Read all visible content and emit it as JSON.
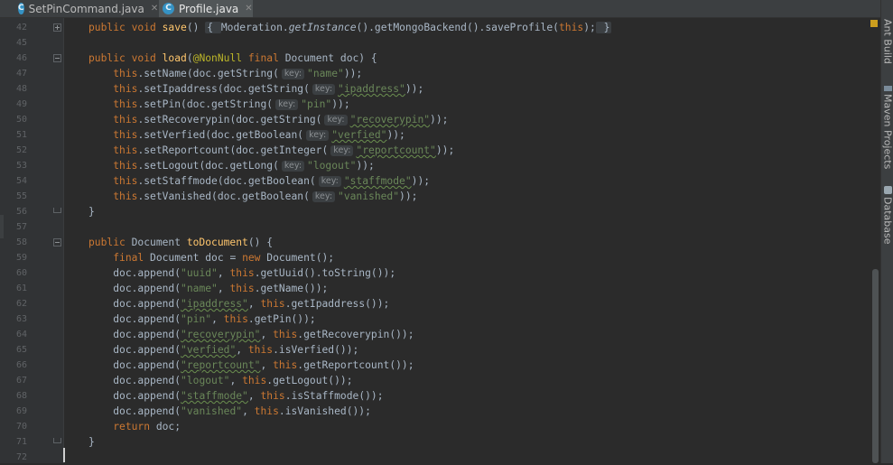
{
  "tabs": [
    {
      "label": "SetPinCommand.java",
      "icon": "class-icon",
      "letter": "C",
      "active": false
    },
    {
      "label": "Profile.java",
      "icon": "class-icon",
      "letter": "C",
      "active": true
    }
  ],
  "right_tool_windows": [
    "Ant Build",
    "Maven Projects",
    "Database"
  ],
  "line_numbers": [
    "42",
    "45",
    "46",
    "47",
    "48",
    "49",
    "50",
    "51",
    "52",
    "53",
    "54",
    "55",
    "56",
    "57",
    "58",
    "59",
    "60",
    "61",
    "62",
    "63",
    "64",
    "65",
    "66",
    "67",
    "68",
    "69",
    "70",
    "71",
    "72"
  ],
  "code_lines": [
    [
      [
        "kw",
        "public void "
      ],
      [
        "fn",
        "save"
      ],
      [
        "tx",
        "() "
      ],
      [
        "fb",
        "{ "
      ],
      [
        "tx",
        "Moderation."
      ],
      [
        "it",
        "getInstance"
      ],
      [
        "tx",
        "().getMongoBackend().saveProfile("
      ],
      [
        "kw",
        "this"
      ],
      [
        "tx",
        ");"
      ],
      [
        "fb",
        " }"
      ]
    ],
    [],
    [
      [
        "kw",
        "public void "
      ],
      [
        "fn",
        "load"
      ],
      [
        "tx",
        "("
      ],
      [
        "ann",
        "@NonNull "
      ],
      [
        "kw",
        "final "
      ],
      [
        "tx",
        "Document doc) {"
      ]
    ],
    [
      [
        "sp",
        "    "
      ],
      [
        "kw",
        "this"
      ],
      [
        "tx",
        ".setName(doc.getString("
      ],
      [
        "hint",
        "key:"
      ],
      [
        "st",
        "\"name\""
      ],
      [
        "tx",
        "));"
      ]
    ],
    [
      [
        "sp",
        "    "
      ],
      [
        "kw",
        "this"
      ],
      [
        "tx",
        ".setIpaddress(doc.getString("
      ],
      [
        "hint",
        "key:"
      ],
      [
        "sty",
        "\"ipaddress\""
      ],
      [
        "tx",
        "));"
      ]
    ],
    [
      [
        "sp",
        "    "
      ],
      [
        "kw",
        "this"
      ],
      [
        "tx",
        ".setPin(doc.getString("
      ],
      [
        "hint",
        "key:"
      ],
      [
        "st",
        "\"pin\""
      ],
      [
        "tx",
        "));"
      ]
    ],
    [
      [
        "sp",
        "    "
      ],
      [
        "kw",
        "this"
      ],
      [
        "tx",
        ".setRecoverypin(doc.getString("
      ],
      [
        "hint",
        "key:"
      ],
      [
        "sty",
        "\"recoverypin\""
      ],
      [
        "tx",
        "));"
      ]
    ],
    [
      [
        "sp",
        "    "
      ],
      [
        "kw",
        "this"
      ],
      [
        "tx",
        ".setVerfied(doc.getBoolean("
      ],
      [
        "hint",
        "key:"
      ],
      [
        "sty",
        "\"verfied\""
      ],
      [
        "tx",
        "));"
      ]
    ],
    [
      [
        "sp",
        "    "
      ],
      [
        "kw",
        "this"
      ],
      [
        "tx",
        ".setReportcount(doc.getInteger("
      ],
      [
        "hint",
        "key:"
      ],
      [
        "sty",
        "\"reportcount\""
      ],
      [
        "tx",
        "));"
      ]
    ],
    [
      [
        "sp",
        "    "
      ],
      [
        "kw",
        "this"
      ],
      [
        "tx",
        ".setLogout(doc.getLong("
      ],
      [
        "hint",
        "key:"
      ],
      [
        "st",
        "\"logout\""
      ],
      [
        "tx",
        "));"
      ]
    ],
    [
      [
        "sp",
        "    "
      ],
      [
        "kw",
        "this"
      ],
      [
        "tx",
        ".setStaffmode(doc.getBoolean("
      ],
      [
        "hint",
        "key:"
      ],
      [
        "sty",
        "\"staffmode\""
      ],
      [
        "tx",
        "));"
      ]
    ],
    [
      [
        "sp",
        "    "
      ],
      [
        "kw",
        "this"
      ],
      [
        "tx",
        ".setVanished(doc.getBoolean("
      ],
      [
        "hint",
        "key:"
      ],
      [
        "st",
        "\"vanished\""
      ],
      [
        "tx",
        "));"
      ]
    ],
    [
      [
        "tx",
        "}"
      ]
    ],
    [],
    [
      [
        "kw",
        "public "
      ],
      [
        "tx",
        "Document "
      ],
      [
        "fn",
        "toDocument"
      ],
      [
        "tx",
        "() {"
      ]
    ],
    [
      [
        "sp",
        "    "
      ],
      [
        "kw",
        "final "
      ],
      [
        "tx",
        "Document doc = "
      ],
      [
        "kw",
        "new "
      ],
      [
        "tx",
        "Document();"
      ]
    ],
    [
      [
        "sp",
        "    "
      ],
      [
        "tx",
        "doc.append("
      ],
      [
        "st",
        "\"uuid\""
      ],
      [
        "tx",
        ", "
      ],
      [
        "kw",
        "this"
      ],
      [
        "tx",
        ".getUuid().toString());"
      ]
    ],
    [
      [
        "sp",
        "    "
      ],
      [
        "tx",
        "doc.append("
      ],
      [
        "st",
        "\"name\""
      ],
      [
        "tx",
        ", "
      ],
      [
        "kw",
        "this"
      ],
      [
        "tx",
        ".getName());"
      ]
    ],
    [
      [
        "sp",
        "    "
      ],
      [
        "tx",
        "doc.append("
      ],
      [
        "sty",
        "\"ipaddress\""
      ],
      [
        "tx",
        ", "
      ],
      [
        "kw",
        "this"
      ],
      [
        "tx",
        ".getIpaddress());"
      ]
    ],
    [
      [
        "sp",
        "    "
      ],
      [
        "tx",
        "doc.append("
      ],
      [
        "st",
        "\"pin\""
      ],
      [
        "tx",
        ", "
      ],
      [
        "kw",
        "this"
      ],
      [
        "tx",
        ".getPin());"
      ]
    ],
    [
      [
        "sp",
        "    "
      ],
      [
        "tx",
        "doc.append("
      ],
      [
        "sty",
        "\"recoverypin\""
      ],
      [
        "tx",
        ", "
      ],
      [
        "kw",
        "this"
      ],
      [
        "tx",
        ".getRecoverypin());"
      ]
    ],
    [
      [
        "sp",
        "    "
      ],
      [
        "tx",
        "doc.append("
      ],
      [
        "sty",
        "\"verfied\""
      ],
      [
        "tx",
        ", "
      ],
      [
        "kw",
        "this"
      ],
      [
        "tx",
        ".isVerfied());"
      ]
    ],
    [
      [
        "sp",
        "    "
      ],
      [
        "tx",
        "doc.append("
      ],
      [
        "sty",
        "\"reportcount\""
      ],
      [
        "tx",
        ", "
      ],
      [
        "kw",
        "this"
      ],
      [
        "tx",
        ".getReportcount());"
      ]
    ],
    [
      [
        "sp",
        "    "
      ],
      [
        "tx",
        "doc.append("
      ],
      [
        "st",
        "\"logout\""
      ],
      [
        "tx",
        ", "
      ],
      [
        "kw",
        "this"
      ],
      [
        "tx",
        ".getLogout());"
      ]
    ],
    [
      [
        "sp",
        "    "
      ],
      [
        "tx",
        "doc.append("
      ],
      [
        "sty",
        "\"staffmode\""
      ],
      [
        "tx",
        ", "
      ],
      [
        "kw",
        "this"
      ],
      [
        "tx",
        ".isStaffmode());"
      ]
    ],
    [
      [
        "sp",
        "    "
      ],
      [
        "tx",
        "doc.append("
      ],
      [
        "st",
        "\"vanished\""
      ],
      [
        "tx",
        ", "
      ],
      [
        "kw",
        "this"
      ],
      [
        "tx",
        ".isVanished());"
      ]
    ],
    [
      [
        "sp",
        "    "
      ],
      [
        "kw",
        "return "
      ],
      [
        "tx",
        "doc;"
      ]
    ],
    [
      [
        "tx",
        "}"
      ]
    ],
    []
  ]
}
